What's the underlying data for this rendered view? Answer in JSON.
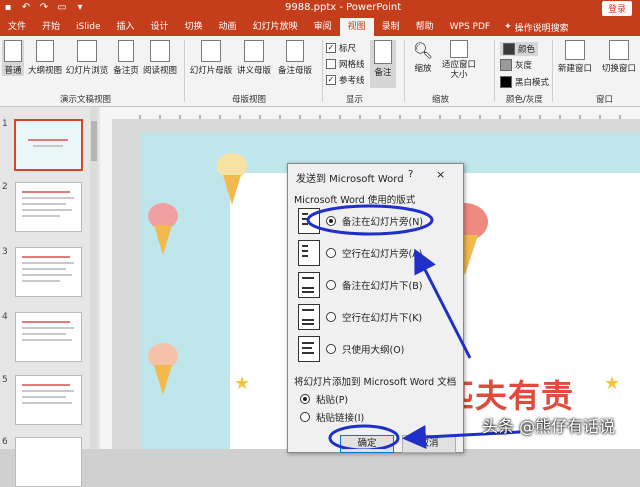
{
  "titlebar": {
    "title": "9988.pptx  -  PowerPoint",
    "login": "登录",
    "qat": [
      "save-icon",
      "undo-icon",
      "redo-icon",
      "present-icon",
      "customize-icon"
    ]
  },
  "menu": {
    "tabs": [
      "文件",
      "开始",
      "iSlide",
      "插入",
      "设计",
      "切换",
      "动画",
      "幻灯片放映",
      "审阅",
      "视图",
      "录制",
      "帮助",
      "WPS PDF"
    ],
    "active": "视图",
    "search_label": "操作说明搜索"
  },
  "ribbon": {
    "views": [
      "普通",
      "大纲视图",
      "幻灯片浏览",
      "备注页",
      "阅读视图"
    ],
    "views_group": "演示文稿视图",
    "masters": [
      "幻灯片母版",
      "讲义母版",
      "备注母版"
    ],
    "masters_group": "母版视图",
    "show": [
      "标尺",
      "网格线",
      "参考线"
    ],
    "show_checked": [
      true,
      false,
      true
    ],
    "notes_btn": "备注",
    "show_group": "显示",
    "zoom": [
      "缩放",
      "适应窗口大小"
    ],
    "zoom_group": "缩放",
    "colors": [
      "颜色",
      "灰度",
      "黑白模式"
    ],
    "color_colors": [
      "#3a3a3a",
      "#9a9a9a",
      "#000000"
    ],
    "colors_group": "颜色/灰度",
    "window": [
      "新建窗口",
      "切换窗口"
    ],
    "window_group": "窗口"
  },
  "slides": [
    "1",
    "2",
    "3",
    "4",
    "5",
    "6"
  ],
  "dialog": {
    "title": "发送到 Microsoft Word",
    "help": "?",
    "close": "×",
    "layout_label": "Microsoft Word 使用的版式",
    "options": [
      {
        "label": "备注在幻灯片旁(N)",
        "selected": true
      },
      {
        "label": "空行在幻灯片旁(A)",
        "selected": false
      },
      {
        "label": "备注在幻灯片下(B)",
        "selected": false
      },
      {
        "label": "空行在幻灯片下(K)",
        "selected": false
      },
      {
        "label": "只使用大纲(O)",
        "selected": false
      }
    ],
    "add_label": "将幻灯片添加到 Microsoft Word 文档",
    "paste_options": [
      {
        "label": "粘贴(P)",
        "selected": true
      },
      {
        "label": "粘贴链接(I)",
        "selected": false
      }
    ],
    "ok": "确定",
    "cancel": "取消"
  },
  "slide_text": "匹夫有责",
  "watermark": "头条 @熊仔有话说",
  "accent": "#c43e1c",
  "annotation_color": "#1f2fc8"
}
